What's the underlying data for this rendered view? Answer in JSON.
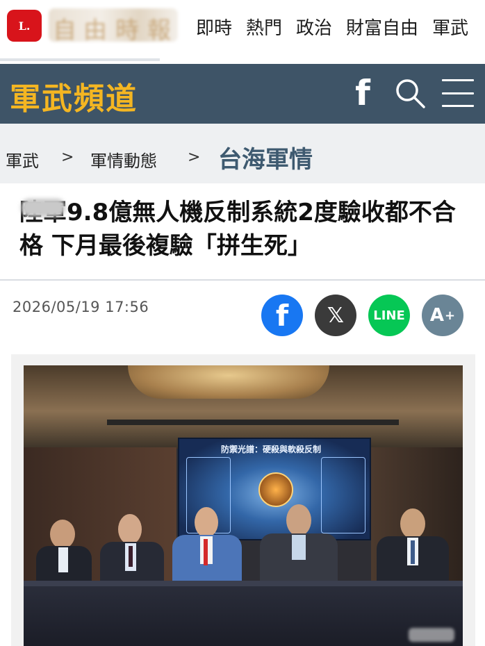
{
  "topnav": {
    "logo_text": "L.",
    "brand_blur_chars": [
      "自",
      "由",
      "時",
      "報"
    ],
    "items": [
      "即時",
      "熱門",
      "政治",
      "財富自由",
      "軍武"
    ]
  },
  "channel": {
    "title": "軍武頻道",
    "facebook_glyph": "f"
  },
  "breadcrumb": {
    "items": [
      "軍武",
      "軍情動態",
      "台海軍情"
    ],
    "separator": ">"
  },
  "article": {
    "headline": "陸軍9.8億無人機反制系統2度驗收都不合格 下月最後複驗「拼生死」",
    "date": "2026/05/19 17:56"
  },
  "share": {
    "facebook_glyph": "f",
    "x_glyph": "𝕏",
    "line_label": "LINE",
    "font_size_glyph": "A",
    "font_size_plus": "+"
  },
  "photo": {
    "screen_title": "防禦光譜：硬殺與軟殺反制"
  },
  "colors": {
    "channel_bg": "#3e5467",
    "channel_title": "#f4b622",
    "breadcrumb_active": "#3e5a70",
    "facebook": "#1877f2",
    "x": "#3a3a3a",
    "line": "#06c755",
    "font_size": "#6a8596"
  }
}
